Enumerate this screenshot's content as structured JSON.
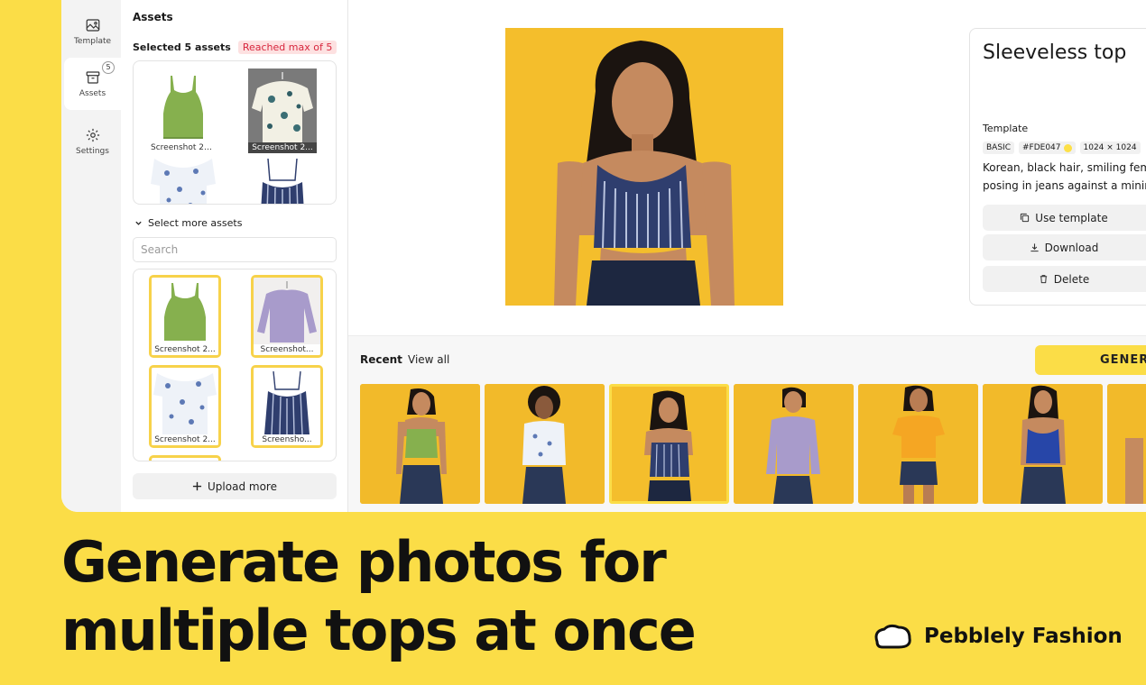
{
  "rail": {
    "template": "Template",
    "assets": "Assets",
    "assets_badge": "5",
    "settings": "Settings"
  },
  "assets_panel": {
    "title": "Assets",
    "selected_text": "Selected 5 assets",
    "max_badge": "Reached max of 5",
    "selected_items": [
      {
        "caption": "Screenshot 20..."
      },
      {
        "caption": "Screenshot 2..."
      }
    ],
    "select_more": "Select more assets",
    "search_placeholder": "Search",
    "grid_items": [
      {
        "caption": "Screenshot 2..."
      },
      {
        "caption": "Screenshot..."
      },
      {
        "caption": "Screenshot 2..."
      },
      {
        "caption": "Screensho..."
      }
    ],
    "upload_more": "Upload more"
  },
  "detail": {
    "title": "Sleeveless top",
    "template_label": "Template",
    "tags": [
      "BASIC",
      "#FDE047",
      "1024 × 1024"
    ],
    "prompt_lines": [
      "Korean, black hair, smiling femal",
      "posing in jeans against a minima"
    ],
    "use_template": "Use template",
    "download": "Download",
    "delete": "Delete"
  },
  "recent": {
    "label": "Recent",
    "view_all": "View all",
    "generate": "GENERA"
  },
  "banner": {
    "line1": "Generate photos for",
    "line2": "multiple tops at once",
    "brand": "Pebblely Fashion"
  },
  "colors": {
    "background": "#FBDD47",
    "accent": "#FDE047",
    "badge_red": "#D7263D"
  }
}
